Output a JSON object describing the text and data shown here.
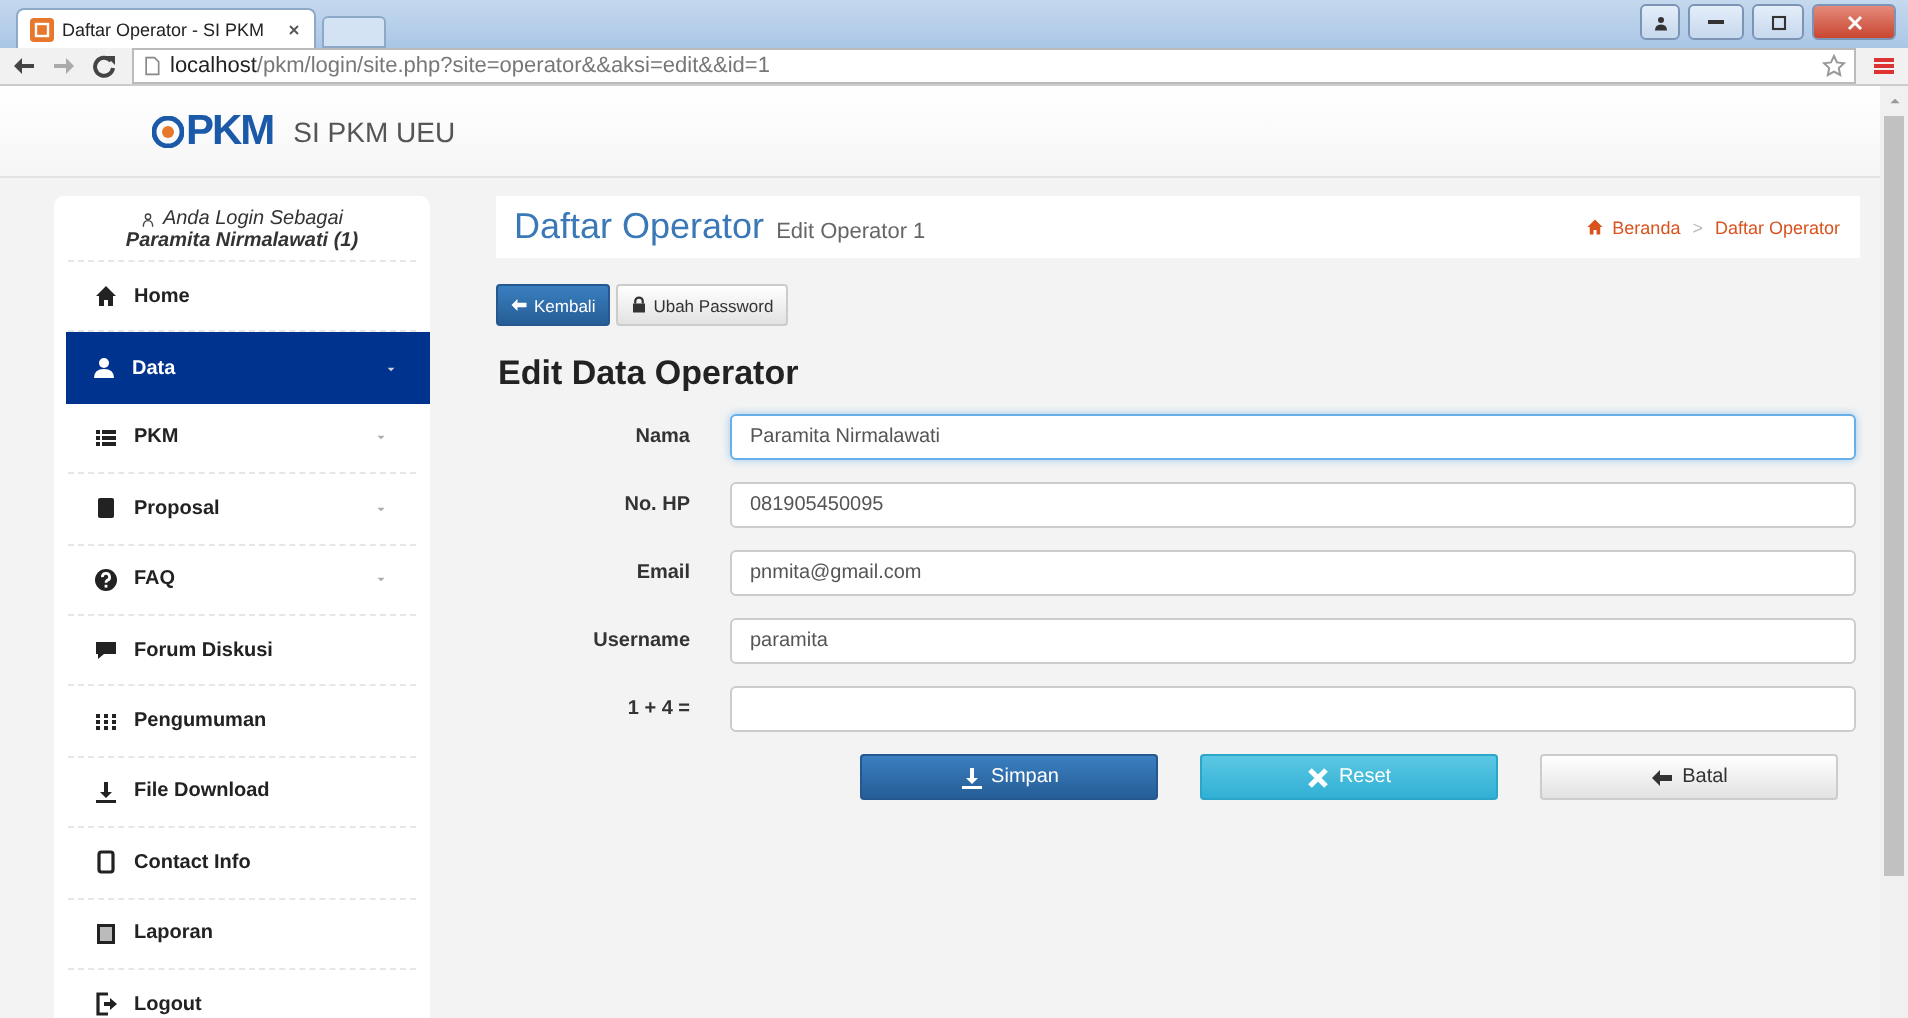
{
  "browser": {
    "tab_title": "Daftar Operator - SI PKM",
    "url": "**localhost**/pkm/login/site.php?site=operator&&aksi=edit&&id=1"
  },
  "header": {
    "logo_text": "PKM",
    "app_title": "SI PKM UEU"
  },
  "sidebar": {
    "login_caption": "Anda Login Sebagai",
    "user": "Paramita Nirmalawati (1)",
    "items": [
      {
        "label": "Home",
        "selected": false,
        "submenu": false
      },
      {
        "label": "Data",
        "selected": true,
        "submenu": true
      },
      {
        "label": "PKM",
        "selected": false,
        "submenu": true
      },
      {
        "label": "Proposal",
        "selected": false,
        "submenu": true
      },
      {
        "label": "FAQ",
        "selected": false,
        "submenu": true
      },
      {
        "label": "Forum Diskusi",
        "selected": false,
        "submenu": false
      },
      {
        "label": "Pengumuman",
        "selected": false,
        "submenu": false
      },
      {
        "label": "File Download",
        "selected": false,
        "submenu": false
      },
      {
        "label": "Contact Info",
        "selected": false,
        "submenu": false
      },
      {
        "label": "Laporan",
        "selected": false,
        "submenu": false
      },
      {
        "label": "Logout",
        "selected": false,
        "submenu": false
      }
    ]
  },
  "page_header": {
    "title": "Daftar Operator",
    "subtitle": "Edit Operator 1",
    "breadcrumb": [
      "Beranda",
      "Daftar Operator"
    ],
    "breadcrumb_separator": ">"
  },
  "toolbar": [
    {
      "label": "Kembali",
      "kind": "primary"
    },
    {
      "label": "Ubah Password",
      "kind": "default"
    }
  ],
  "form": {
    "title": "Edit Data Operator",
    "fields": [
      {
        "label": "Nama",
        "value": "Paramita Nirmalawati",
        "focused": true
      },
      {
        "label": "No. HP",
        "value": "081905450095",
        "focused": false
      },
      {
        "label": "Email",
        "value": "pnmita@gmail.com",
        "focused": false
      },
      {
        "label": "Username",
        "value": "paramita",
        "focused": false
      },
      {
        "label": "1 + 4 =",
        "focused": false
      }
    ],
    "buttons": [
      {
        "label": "Simpan",
        "kind": "primary"
      },
      {
        "label": "Reset",
        "kind": "info"
      },
      {
        "label": "Batal",
        "kind": "default"
      }
    ]
  }
}
